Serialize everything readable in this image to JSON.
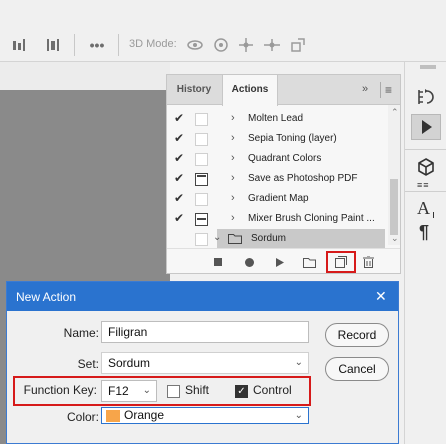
{
  "options_bar": {
    "mode_3d_label": "3D Mode:",
    "icons": [
      "align-top-icon",
      "align-center-icon",
      "more-icon",
      "orbit-icon",
      "roll-icon",
      "pan-icon",
      "slide-icon",
      "scale-icon"
    ]
  },
  "actions_panel": {
    "tabs": [
      {
        "label": "History"
      },
      {
        "label": "Actions"
      }
    ],
    "items": [
      {
        "checked": true,
        "dialog_toggle": false,
        "label": "Molten Lead"
      },
      {
        "checked": true,
        "dialog_toggle": false,
        "label": "Sepia Toning (layer)"
      },
      {
        "checked": true,
        "dialog_toggle": false,
        "label": "Quadrant Colors"
      },
      {
        "checked": true,
        "dialog_toggle": true,
        "label": "Save as Photoshop PDF"
      },
      {
        "checked": true,
        "dialog_toggle": false,
        "label": "Gradient Map"
      },
      {
        "checked": true,
        "dialog_toggle": true,
        "label": "Mixer Brush Cloning Paint ..."
      },
      {
        "checked": false,
        "dialog_toggle": false,
        "label": "Sordum",
        "selected": true
      }
    ],
    "footer_buttons": [
      "stop-icon",
      "record-icon",
      "play-icon",
      "new-set-icon",
      "new-action-icon",
      "delete-icon"
    ]
  },
  "new_action_dialog": {
    "title": "New Action",
    "name_label": "Name:",
    "name_value": "Filigran",
    "set_label": "Set:",
    "set_value": "Sordum",
    "function_key_label": "Function Key:",
    "function_key_value": "F12",
    "shift_label": "Shift",
    "shift_checked": false,
    "control_label": "Control",
    "control_checked": true,
    "color_label": "Color:",
    "color_value": "Orange",
    "color_swatch": "#f7a54a",
    "record_label": "Record",
    "cancel_label": "Cancel"
  },
  "accent_colors": {
    "titlebar": "#2a73cf",
    "highlight_outline": "#d61a1a"
  }
}
